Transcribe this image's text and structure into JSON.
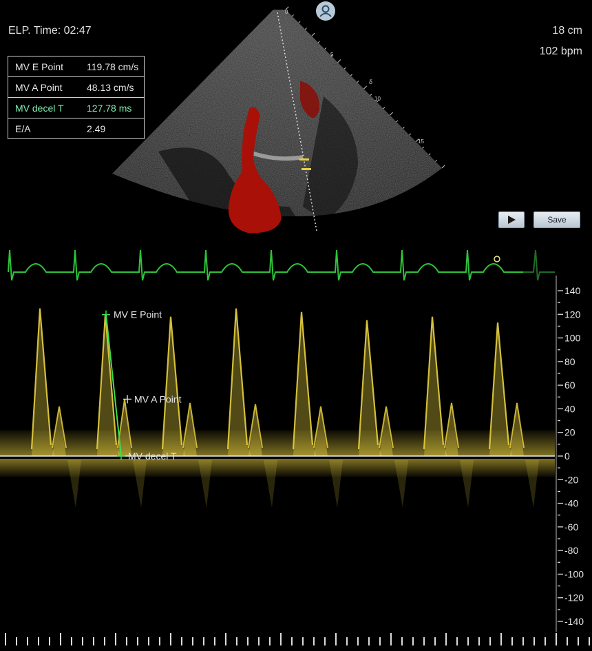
{
  "status": {
    "elapsed": "ELP. Time: 02:47",
    "depth": "18 cm",
    "heart_rate": "102 bpm"
  },
  "measurements": [
    {
      "label": "MV E Point",
      "value": "119.78 cm/s",
      "highlight": false
    },
    {
      "label": "MV A Point",
      "value": "48.13 cm/s",
      "highlight": false
    },
    {
      "label": "MV decel T",
      "value": "127.78 ms",
      "highlight": true
    },
    {
      "label": "E/A",
      "value": "2.49",
      "highlight": false
    }
  ],
  "sector_depth_labels": [
    "0",
    "5",
    "10",
    "15"
  ],
  "controls": {
    "play_icon": "play-icon",
    "save_label": "Save"
  },
  "doppler": {
    "scale_unit": "cm/s",
    "ticks": [
      140,
      120,
      100,
      80,
      60,
      40,
      20,
      0,
      -20,
      -40,
      -60,
      -80,
      -100,
      -120,
      -140
    ],
    "ymin": -140,
    "ymax": 140,
    "markers": {
      "e_point": "MV E Point",
      "a_point": "MV A Point",
      "decel": "MV decel T"
    },
    "e_point_value": 119.78,
    "a_point_value": 48.13,
    "beats": [
      {
        "e": 125,
        "a": 42
      },
      {
        "e": 120,
        "a": 48
      },
      {
        "e": 118,
        "a": 45
      },
      {
        "e": 125,
        "a": 44
      },
      {
        "e": 122,
        "a": 42
      },
      {
        "e": 115,
        "a": 42
      },
      {
        "e": 118,
        "a": 45
      },
      {
        "e": 113,
        "a": 45
      }
    ]
  },
  "colors": {
    "doppler": "#e8d040",
    "ecg": "#2ec43a",
    "caliper": "#38e050",
    "flow": "#b01208"
  }
}
